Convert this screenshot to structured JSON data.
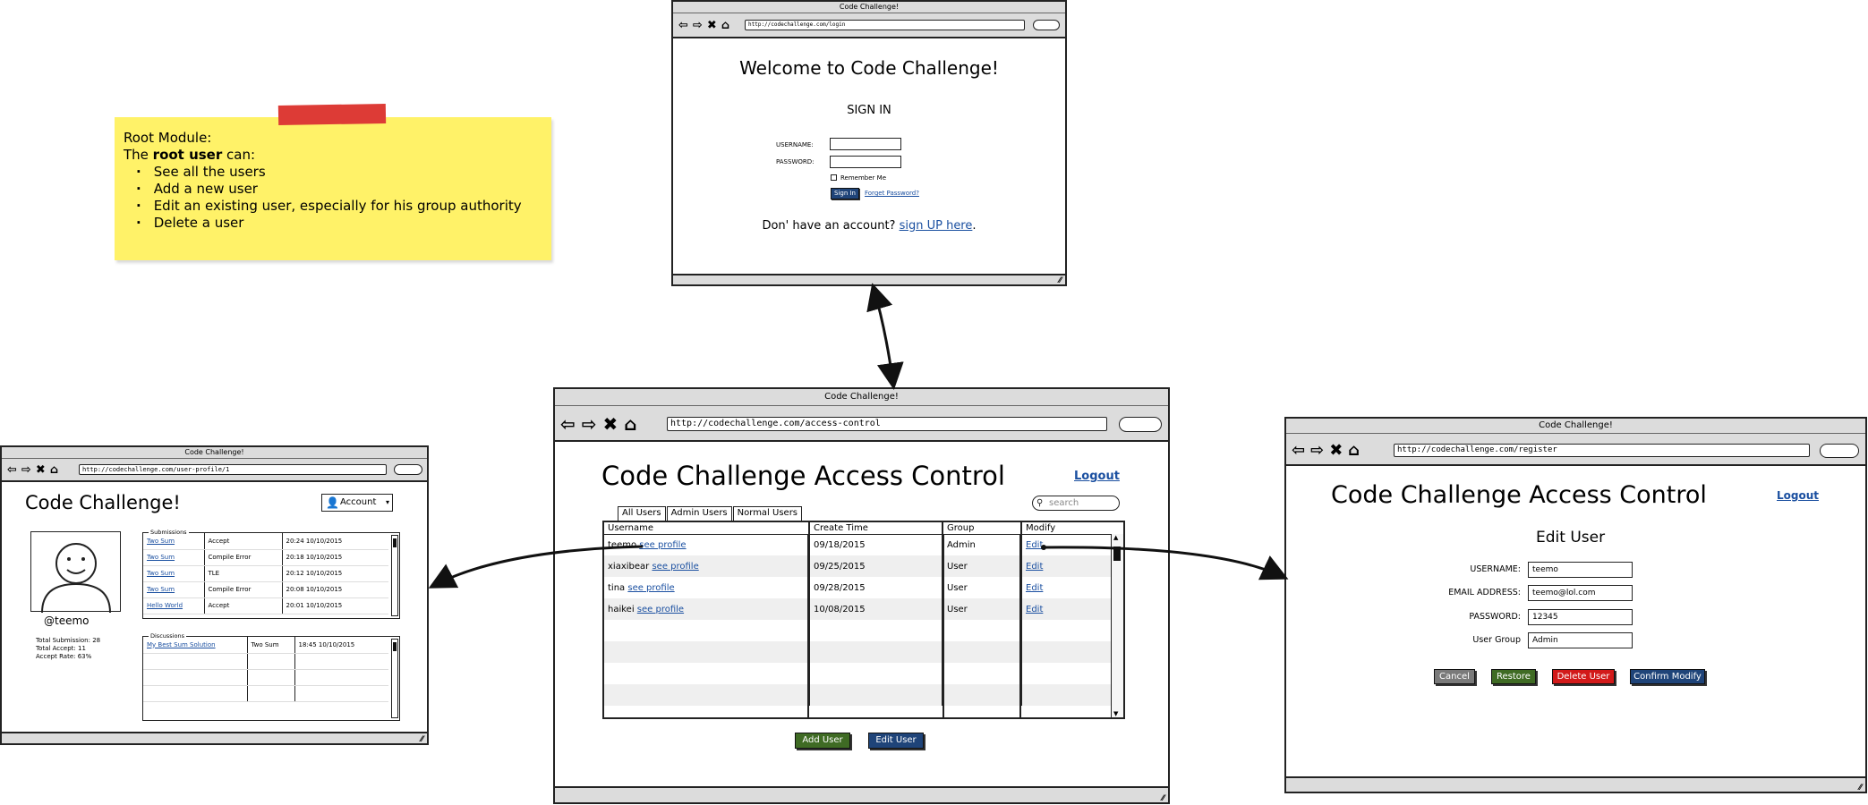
{
  "note": {
    "title": "Root Module:",
    "intro_prefix": "The ",
    "intro_bold": "root user",
    "intro_suffix": " can:",
    "items": [
      "See all the users",
      "Add a new user",
      "Edit an existing user, especially for his group authority",
      "Delete a user"
    ]
  },
  "signin": {
    "window_title": "Code Challenge!",
    "url": "http://codechallenge.com/login",
    "heading": "Welcome to Code Challenge!",
    "subheading": "SIGN IN",
    "username_label": "USERNAME:",
    "password_label": "PASSWORD:",
    "remember_label": "Remember Me",
    "signin_button": "Sign In",
    "forget_link": "Forget Password?",
    "signup_prefix": "Don' have an account?",
    "signup_link": "sign UP here",
    "signup_suffix": "."
  },
  "access": {
    "window_title": "Code Challenge!",
    "url": "http://codechallenge.com/access-control",
    "heading": "Code Challenge Access Control",
    "logout": "Logout",
    "search_placeholder": "search",
    "tabs": [
      "All Users",
      "Admin Users",
      "Normal Users"
    ],
    "columns": [
      "Username",
      "Create Time",
      "Group",
      "Modify"
    ],
    "rows": [
      {
        "name": "teemo",
        "profile": "see profile",
        "time": "09/18/2015",
        "group": "Admin",
        "modify": "Edit"
      },
      {
        "name": "xiaxibear",
        "profile": "see profile",
        "time": "09/25/2015",
        "group": "User",
        "modify": "Edit"
      },
      {
        "name": "tina",
        "profile": "see profile",
        "time": "09/28/2015",
        "group": "User",
        "modify": "Edit"
      },
      {
        "name": "haikei",
        "profile": "see profile",
        "time": "10/08/2015",
        "group": "User",
        "modify": "Edit"
      }
    ],
    "add_button": "Add User",
    "edit_button": "Edit User"
  },
  "register": {
    "window_title": "Code Challenge!",
    "url": "http://codechallenge.com/register",
    "heading": "Code Challenge Access Control",
    "logout": "Logout",
    "subheading": "Edit User",
    "fields": [
      {
        "label": "USERNAME:",
        "value": "teemo"
      },
      {
        "label": "EMAIL ADDRESS:",
        "value": "teemo@lol.com"
      },
      {
        "label": "PASSWORD:",
        "value": "12345"
      },
      {
        "label": "User Group",
        "value": "Admin"
      }
    ],
    "buttons": {
      "cancel": "Cancel",
      "restore": "Restore",
      "delete": "Delete User",
      "confirm": "Confirm Modify"
    }
  },
  "profile": {
    "window_title": "Code Challenge!",
    "url": "http://codechallenge.com/user-profile/1",
    "heading": "Code Challenge!",
    "account": "Account",
    "username": "@teemo",
    "stats": [
      "Total Submission: 28",
      "Total Accept: 11",
      "Accept Rate: 63%"
    ],
    "submissions_legend": "Submissions",
    "submissions": [
      {
        "problem": "Two Sum",
        "result": "Accept",
        "time": "20:24 10/10/2015"
      },
      {
        "problem": "Two Sum",
        "result": "Compile Error",
        "time": "20:18 10/10/2015"
      },
      {
        "problem": "Two Sum",
        "result": "TLE",
        "time": "20:12 10/10/2015"
      },
      {
        "problem": "Two Sum",
        "result": "Compile Error",
        "time": "20:08 10/10/2015"
      },
      {
        "problem": "Hello World",
        "result": "Accept",
        "time": "20:01 10/10/2015"
      }
    ],
    "discussions_legend": "Discussions",
    "discussions": [
      {
        "title": "My Best Sum Solution",
        "problem": "Two Sum",
        "time": "18:45 10/10/2015"
      }
    ]
  },
  "colors": {
    "note": "#fff268",
    "tape": "#dd3b36",
    "link": "#1a4fa0",
    "btn_green": "#3f6b24",
    "btn_blue": "#1f4479",
    "btn_red": "#d21a1a",
    "btn_gray": "#7a7a7a"
  }
}
